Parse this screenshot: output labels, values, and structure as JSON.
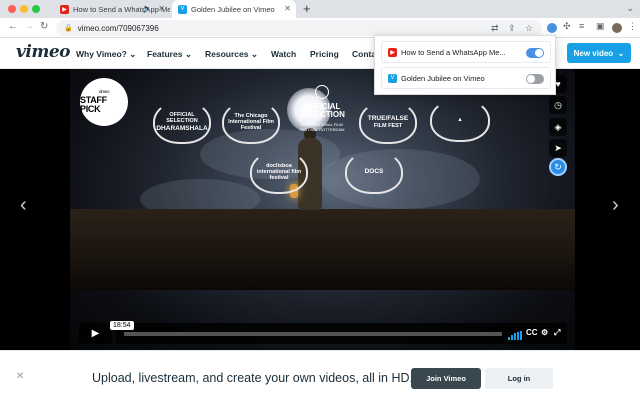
{
  "browser": {
    "tabs": [
      {
        "title": "How to Send a WhatsApp Messa",
        "favicon": "youtube-icon",
        "active": false
      },
      {
        "title": "Golden Jubilee on Vimeo",
        "favicon": "vimeo-icon",
        "active": true
      }
    ],
    "url": "vimeo.com/709067396"
  },
  "header": {
    "logo": "vimeo",
    "nav": [
      "Why Vimeo?",
      "Features",
      "Resources",
      "Watch",
      "Pricing",
      "Conta"
    ],
    "new_video": "New video"
  },
  "popup": {
    "items": [
      {
        "label": "How to Send a WhatsApp Me...",
        "icon": "youtube-icon",
        "enabled": true
      },
      {
        "label": "Golden Jubilee on Vimeo",
        "icon": "vimeo-icon",
        "enabled": false
      }
    ]
  },
  "video": {
    "badges": {
      "staff_pick_small": "vimeo",
      "staff_pick": "STAFF PICK",
      "dharamshala_top": "OFFICIAL SELECTION",
      "dharamshala": "DHARAMSHALA",
      "chicago": "The Chicago International Film Festival",
      "official_selection": "OFFICIAL SELECTION",
      "official_selection_sub": "INTERNATIONAL FILM FESTIVAL ROTTERDAM",
      "true_false": "TRUE/FALSE",
      "true_false_sub": "FILM FEST",
      "doclisboa": "doclisboa international film festival",
      "docs": "DOCS"
    },
    "timecode": "18:54",
    "progress": 0,
    "quality_label": "CC"
  },
  "footer": {
    "text": "Upload, livestream, and create your own videos, all in HD.",
    "join": "Join Vimeo",
    "login": "Log in"
  },
  "colors": {
    "vimeo_blue": "#17a0e6",
    "toggle_on": "#4a90e2",
    "toggle_off": "#9aa0a6",
    "youtube_red": "#e62117",
    "join_button": "#39474f"
  }
}
